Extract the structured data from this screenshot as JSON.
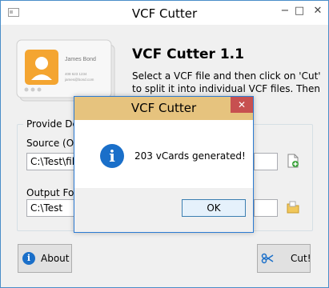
{
  "window": {
    "title": "VCF Cutter"
  },
  "controls": {
    "minimize": "−",
    "maximize": "□",
    "close": "✕"
  },
  "card": {
    "name": "James Bond",
    "phone": "408 623 1234",
    "email": "james@bond.com"
  },
  "heading": "VCF Cutter 1.1",
  "description": "Select a VCF file and then click on 'Cut' to split it into individual VCF files. Then you",
  "group": {
    "title": "Provide Det"
  },
  "source": {
    "label": "Source (Or",
    "value": "C:\\Test\\fil"
  },
  "output": {
    "label": "Output Fol",
    "value": "C:\\Test"
  },
  "buttons": {
    "about": "About",
    "cut": "Cut!"
  },
  "dialog": {
    "title": "VCF Cutter",
    "close": "✕",
    "message": "203 vCards generated!",
    "ok": "OK"
  },
  "icons": {
    "info": "i",
    "cut": "scissors-icon",
    "add_file": "add-file-icon",
    "folder": "folder-icon"
  },
  "colors": {
    "accent": "#1a6fc9",
    "dialog_titlebar": "#e6c37e",
    "close_red": "#c75050"
  }
}
